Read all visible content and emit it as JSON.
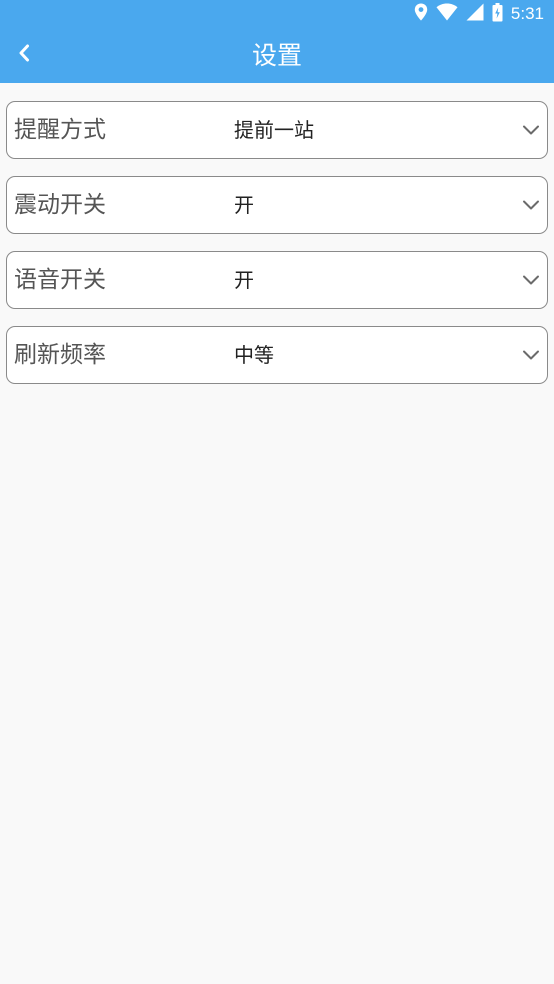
{
  "status_bar": {
    "time": "5:31",
    "icons": [
      "location-icon",
      "wifi-icon",
      "signal-icon",
      "battery-icon"
    ]
  },
  "app_bar": {
    "title": "设置",
    "back_icon": "chevron-left-icon"
  },
  "colors": {
    "primary": "#4aa8ee",
    "background": "#f9f9f9",
    "row_border": "#8a8a8a"
  },
  "settings": [
    {
      "label": "提醒方式",
      "value": "提前一站"
    },
    {
      "label": "震动开关",
      "value": "开"
    },
    {
      "label": "语音开关",
      "value": "开"
    },
    {
      "label": "刷新频率",
      "value": "中等"
    }
  ]
}
